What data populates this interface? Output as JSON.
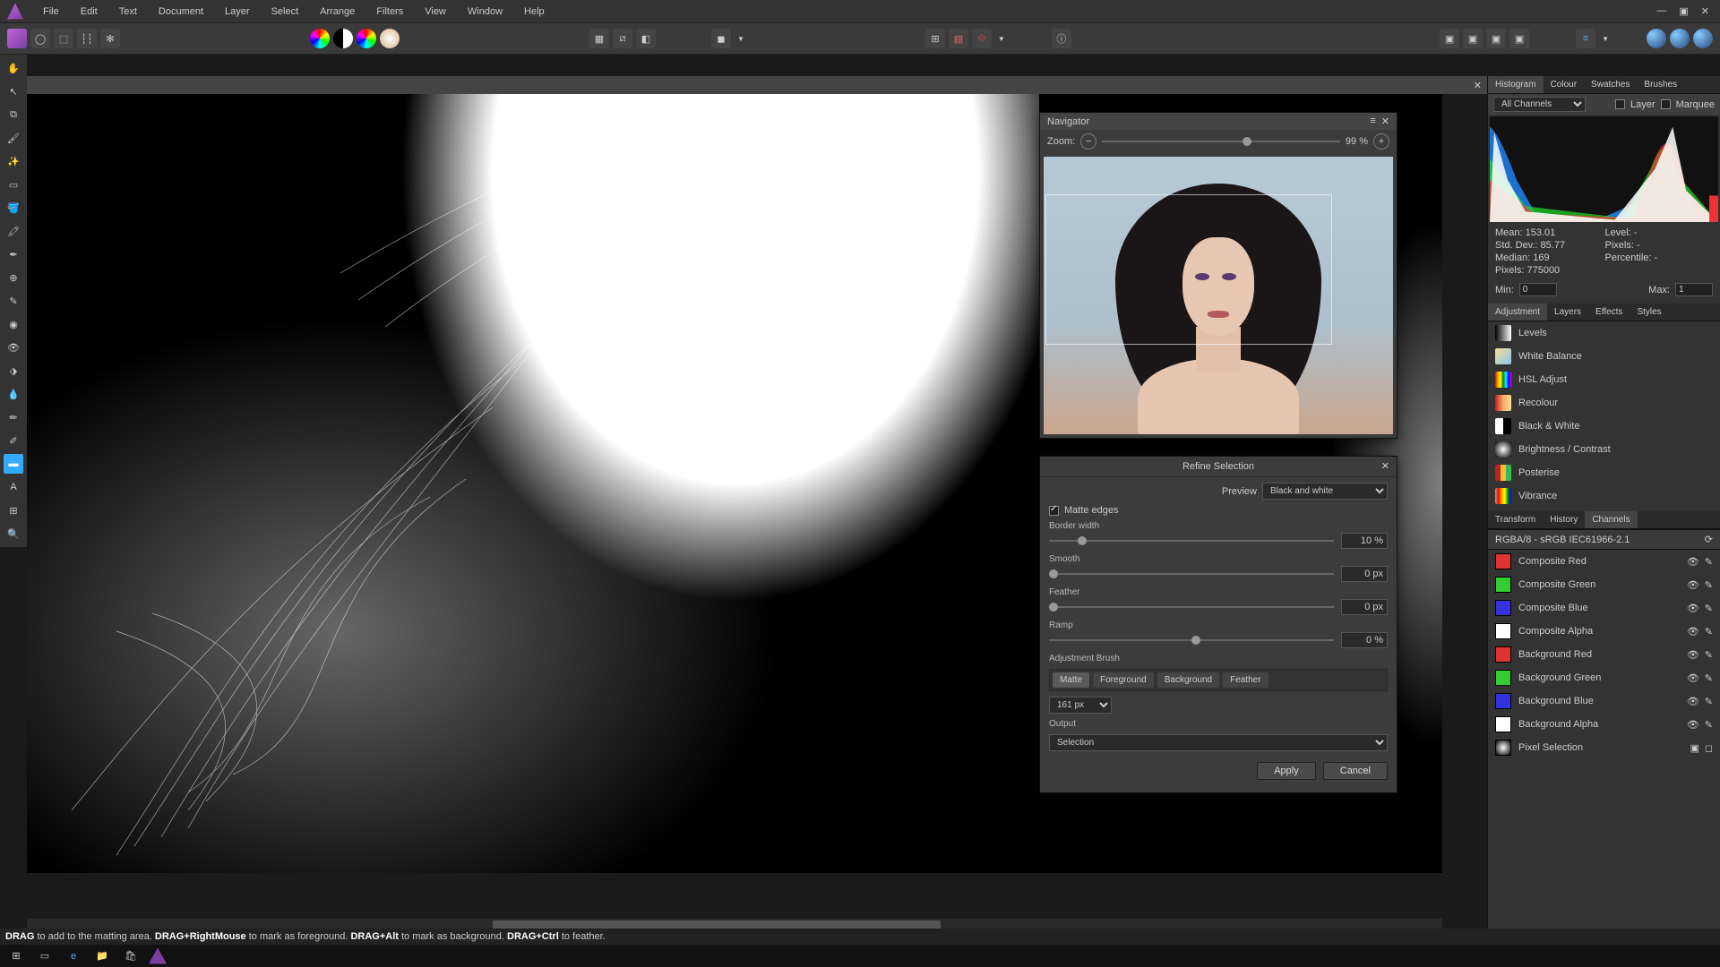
{
  "menu": [
    "File",
    "Edit",
    "Text",
    "Document",
    "Layer",
    "Select",
    "Arrange",
    "Filters",
    "View",
    "Window",
    "Help"
  ],
  "navigator": {
    "title": "Navigator",
    "zoom_label": "Zoom:",
    "zoom_value": "99 %"
  },
  "refine": {
    "title": "Refine Selection",
    "preview_label": "Preview",
    "preview_value": "Black and white",
    "matte_edges": "Matte edges",
    "border_width_label": "Border width",
    "border_width_value": "10 %",
    "smooth_label": "Smooth",
    "smooth_value": "0 px",
    "feather_label": "Feather",
    "feather_value": "0 px",
    "ramp_label": "Ramp",
    "ramp_value": "0 %",
    "adjustment_brush": "Adjustment Brush",
    "brushes": [
      "Matte",
      "Foreground",
      "Background",
      "Feather"
    ],
    "brush_size": "161 px",
    "output_label": "Output",
    "output_value": "Selection",
    "apply": "Apply",
    "cancel": "Cancel"
  },
  "histogram": {
    "tabs": [
      "Histogram",
      "Colour",
      "Swatches",
      "Brushes"
    ],
    "channel": "All Channels",
    "layer": "Layer",
    "marquee": "Marquee",
    "mean_label": "Mean:",
    "mean": "153.01",
    "std_label": "Std. Dev.:",
    "std": "85.77",
    "median_label": "Median:",
    "median": "169",
    "pixels_label": "Pixels:",
    "pixels": "775000",
    "level_label": "Level:",
    "level": "-",
    "pix2_label": "Pixels:",
    "pix2": "-",
    "pct_label": "Percentile:",
    "pct": "-",
    "min_label": "Min:",
    "min": "0",
    "max_label": "Max:",
    "max": "1"
  },
  "adjustments": {
    "tabs": [
      "Adjustment",
      "Layers",
      "Effects",
      "Styles"
    ],
    "items": [
      {
        "name": "Levels",
        "color": "linear-gradient(90deg,#000,#fff)"
      },
      {
        "name": "White Balance",
        "color": "linear-gradient(135deg,#f7e08c,#8cc5f7)"
      },
      {
        "name": "HSL Adjust",
        "color": "linear-gradient(90deg,red,orange,yellow,green,cyan,blue,magenta)"
      },
      {
        "name": "Recolour",
        "color": "linear-gradient(90deg,#b22,#fa6,#fd9)"
      },
      {
        "name": "Black & White",
        "color": "conic-gradient(#000 0 50%,#fff 50% 100%)"
      },
      {
        "name": "Brightness / Contrast",
        "color": "radial-gradient(circle,#fff,#000)"
      },
      {
        "name": "Posterise",
        "color": "linear-gradient(90deg,#b22 33%,#fb3 33% 66%,#3b5 66%)"
      },
      {
        "name": "Vibrance",
        "color": "linear-gradient(90deg,#aaa,red,orange,yellow,green,blue)"
      }
    ]
  },
  "channels": {
    "tabs": [
      "Transform",
      "History",
      "Channels"
    ],
    "profile": "RGBA/8 - sRGB IEC61966-2.1",
    "items": [
      {
        "name": "Composite Red",
        "c": "#d33"
      },
      {
        "name": "Composite Green",
        "c": "#3c3"
      },
      {
        "name": "Composite Blue",
        "c": "#33d"
      },
      {
        "name": "Composite Alpha",
        "c": "#fff"
      },
      {
        "name": "Background Red",
        "c": "#d33"
      },
      {
        "name": "Background Green",
        "c": "#3c3"
      },
      {
        "name": "Background Blue",
        "c": "#33d"
      },
      {
        "name": "Background Alpha",
        "c": "#fff"
      },
      {
        "name": "Pixel Selection",
        "c": "radial"
      }
    ]
  },
  "status": {
    "s1a": "DRAG",
    "s1b": " to add to the matting area. ",
    "s2a": "DRAG+RightMouse",
    "s2b": " to mark as foreground. ",
    "s3a": "DRAG+Alt",
    "s3b": " to mark as background. ",
    "s4a": "DRAG+Ctrl",
    "s4b": " to feather."
  }
}
